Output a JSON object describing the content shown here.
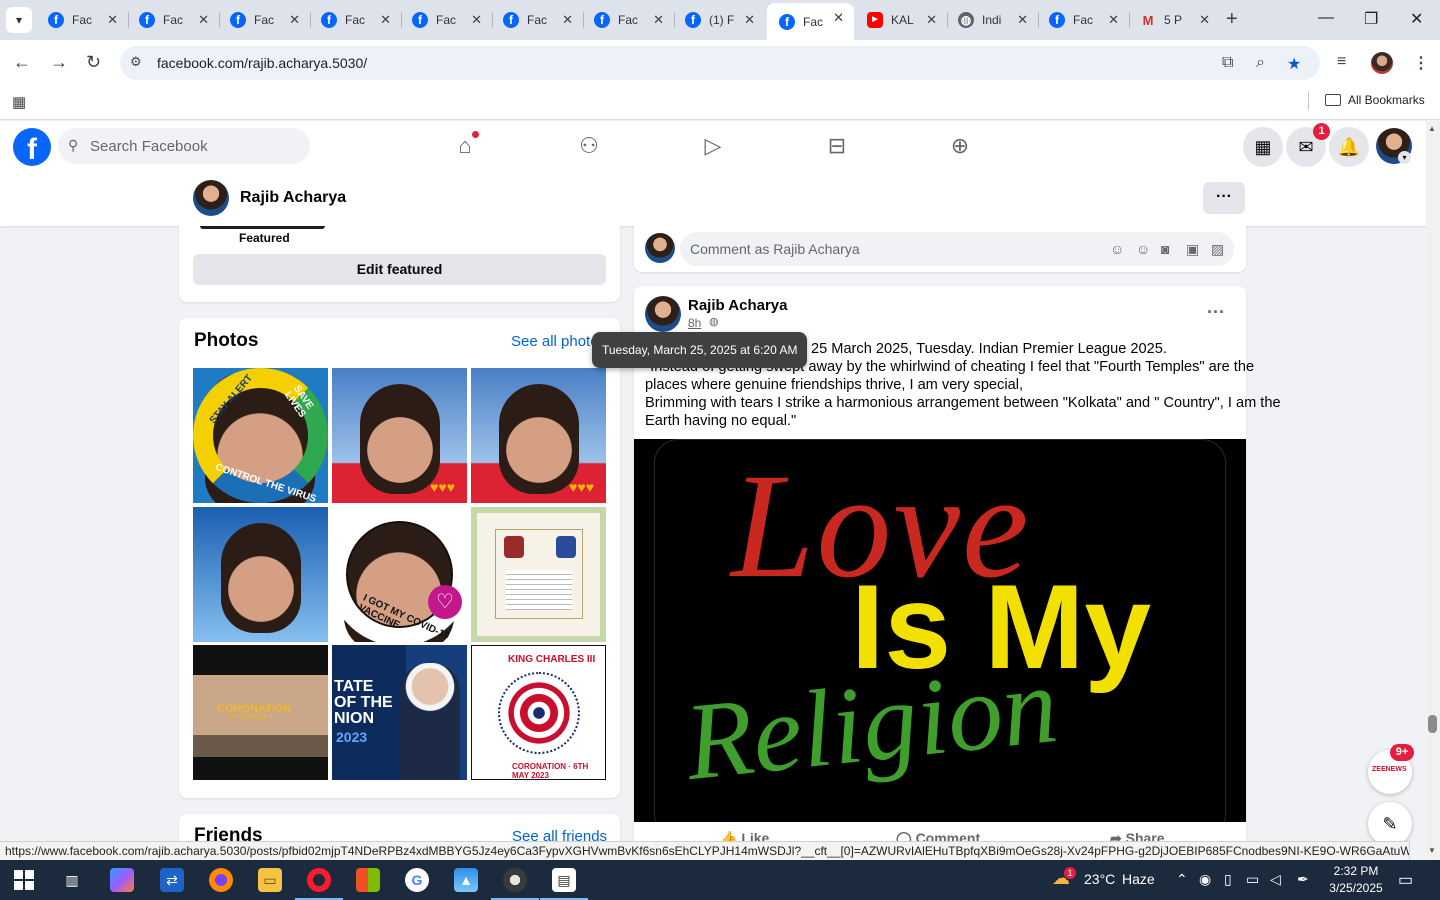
{
  "browser": {
    "tabs": [
      {
        "title": "Fac",
        "icon": "facebook-icon"
      },
      {
        "title": "Fac",
        "icon": "facebook-icon"
      },
      {
        "title": "Fac",
        "icon": "facebook-icon"
      },
      {
        "title": "Fac",
        "icon": "facebook-icon"
      },
      {
        "title": "Fac",
        "icon": "facebook-icon"
      },
      {
        "title": "Fac",
        "icon": "facebook-icon"
      },
      {
        "title": "Fac",
        "icon": "facebook-icon"
      },
      {
        "title": "(1) F",
        "icon": "facebook-icon"
      },
      {
        "title": "Fac",
        "icon": "facebook-icon",
        "active": true
      },
      {
        "title": "KAL",
        "icon": "youtube-icon"
      },
      {
        "title": "Indi",
        "icon": "globe-icon"
      },
      {
        "title": "Fac",
        "icon": "facebook-icon"
      },
      {
        "title": "5 P",
        "icon": "gmail-icon"
      }
    ],
    "url": "facebook.com/rajib.acharya.5030/",
    "all_bookmarks": "All Bookmarks",
    "status_url": "https://www.facebook.com/rajib.acharya.5030/posts/pfbid02mjpT4NDeRPBz4xdMBBYG5Jz4ey6Ca3FypvXGHVwmBvKf6sn6sEhCLYPJH14mWSDJl?__cft__[0]=AZWURvIAlEHuTBpfqXBi9mOeGs28j-Xv24pFPHG-g2DjJOEBIP685FCnodbes9NI-KE9O-WR6GaAtuWyag3ch9..."
  },
  "facebook": {
    "search_placeholder": "Search Facebook",
    "messenger_badge": "1",
    "profile_name": "Rajib Acharya",
    "accent": "#0866ff"
  },
  "left": {
    "featured_label": "Featured",
    "edit_featured": "Edit featured",
    "photos_title": "Photos",
    "see_all_photos": "See all photos",
    "friends_title": "Friends",
    "see_all_friends": "See all friends",
    "photo_texts": {
      "p1_a": "STAY ALERT",
      "p1_b": "SAVE LIVES",
      "p1_c": "CONTROL THE VIRUS",
      "p5_a": "I GOT MY COVID-19 VACCINE",
      "p7_a": "CORONATION",
      "p7_b": "OF CHARLES III",
      "p8_a": "TATE",
      "p8_b": "OF THE",
      "p8_c": "NION",
      "p8_d": "2023",
      "p9_a": "KING CHARLES III",
      "p9_b": "CORONATION · 6TH MAY 2023"
    }
  },
  "post": {
    "comment_placeholder": "Comment as Rajib Acharya",
    "author": "Rajib Acharya",
    "time": "8h",
    "tooltip": "Tuesday, March 25, 2025 at 6:20 AM",
    "lines": [
      "25 March 2025, Tuesday. Indian Premier League 2025.",
      "\"Instead of getting swept away by the whirlwind of cheating I feel that \"Fourth Temples\" are the",
      "places where genuine friendships thrive, I am very special,",
      "Brimming with tears I strike a harmonious arrangement between \"Kolkata\" and \" Country\", I am the",
      "Earth having no equal.\""
    ],
    "image_words": {
      "w1": "Love",
      "w2": "Is My",
      "w3": "Religion"
    },
    "actions": {
      "like": "Like",
      "comment": "Comment",
      "share": "Share"
    }
  },
  "floating": {
    "zee_label": "ZEENEWS",
    "zee_badge": "9+"
  },
  "taskbar": {
    "weather_temp": "23°C",
    "weather_text": "Haze",
    "weather_badge": "1",
    "time": "2:32 PM",
    "date": "3/25/2025"
  }
}
